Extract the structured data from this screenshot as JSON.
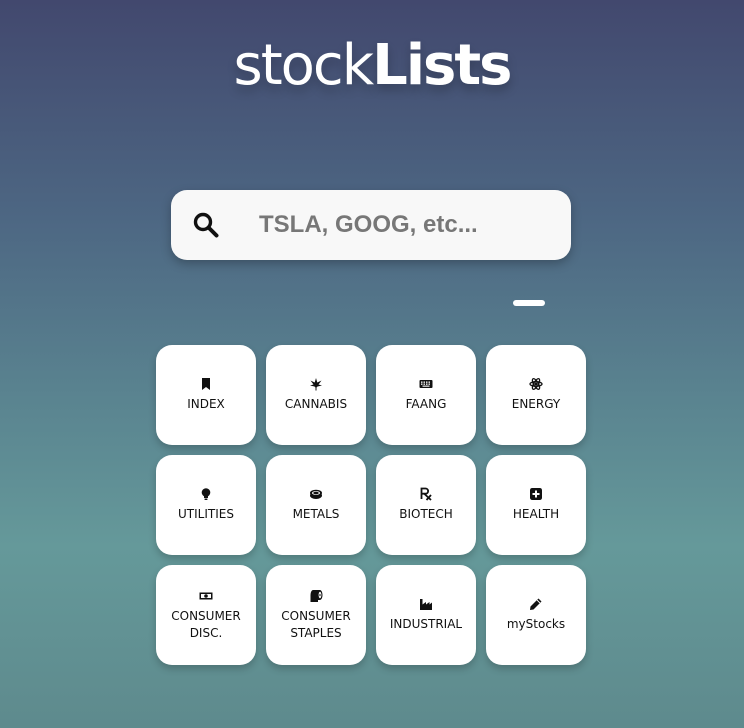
{
  "header": {
    "logo_light": "stock",
    "logo_bold": "Lists"
  },
  "search": {
    "placeholder": "TSLA, GOOG, etc...",
    "value": "",
    "icon": "search-icon"
  },
  "categories": [
    {
      "label": "INDEX",
      "icon": "bookmark-icon"
    },
    {
      "label": "CANNABIS",
      "icon": "cannabis-leaf-icon"
    },
    {
      "label": "FAANG",
      "icon": "keyboard-icon"
    },
    {
      "label": "ENERGY",
      "icon": "atom-icon"
    },
    {
      "label": "UTILITIES",
      "icon": "lightbulb-icon"
    },
    {
      "label": "METALS",
      "icon": "coin-stack-icon"
    },
    {
      "label": "BIOTECH",
      "icon": "prescription-icon"
    },
    {
      "label": "HEALTH",
      "icon": "medical-plus-icon"
    },
    {
      "label": "CONSUMER\nDISC.",
      "icon": "money-bill-icon"
    },
    {
      "label": "CONSUMER\nSTAPLES",
      "icon": "toilet-paper-icon"
    },
    {
      "label": "INDUSTRIAL",
      "icon": "factory-icon"
    },
    {
      "label": "myStocks",
      "icon": "pencil-icon"
    }
  ]
}
